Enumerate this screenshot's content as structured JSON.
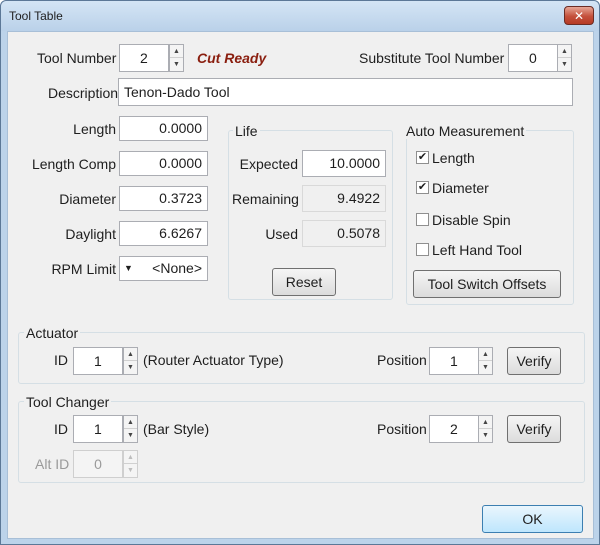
{
  "window": {
    "title": "Tool Table",
    "close_glyph": "✕"
  },
  "tool": {
    "number_label": "Tool Number",
    "number_value": "2",
    "status": "Cut Ready",
    "substitute_label": "Substitute Tool Number",
    "substitute_value": "0",
    "description_label": "Description",
    "description_value": "Tenon-Dado Tool",
    "length_label": "Length",
    "length_value": "0.0000",
    "length_comp_label": "Length Comp",
    "length_comp_value": "0.0000",
    "diameter_label": "Diameter",
    "diameter_value": "0.3723",
    "daylight_label": "Daylight",
    "daylight_value": "6.6267",
    "rpm_label": "RPM Limit",
    "rpm_value": "<None>"
  },
  "life": {
    "title": "Life",
    "expected_label": "Expected",
    "expected_value": "10.0000",
    "remaining_label": "Remaining",
    "remaining_value": "9.4922",
    "used_label": "Used",
    "used_value": "0.5078",
    "reset_label": "Reset"
  },
  "auto_measurement": {
    "title": "Auto Measurement",
    "length_label": "Length",
    "length_checked": true,
    "diameter_label": "Diameter",
    "diameter_checked": true,
    "disable_spin_label": "Disable Spin",
    "disable_spin_checked": false,
    "left_hand_label": "Left Hand Tool",
    "left_hand_checked": false,
    "offsets_label": "Tool Switch Offsets"
  },
  "actuator": {
    "title": "Actuator",
    "id_label": "ID",
    "id_value": "1",
    "type_text": "(Router Actuator Type)",
    "position_label": "Position",
    "position_value": "1",
    "verify_label": "Verify"
  },
  "tool_changer": {
    "title": "Tool Changer",
    "id_label": "ID",
    "id_value": "1",
    "style_text": "(Bar Style)",
    "position_label": "Position",
    "position_value": "2",
    "verify_label": "Verify",
    "alt_id_label": "Alt ID",
    "alt_id_value": "0"
  },
  "footer": {
    "ok_label": "OK"
  },
  "glyphs": {
    "spin_up": "▲",
    "spin_down": "▼",
    "check": "✔",
    "dropdown": "▼"
  },
  "colors": {
    "title_bar": "#bad1e9",
    "close_button": "#c4503b",
    "status_text": "#8a1e0f",
    "dialog_bg": "#f0f0f0"
  }
}
